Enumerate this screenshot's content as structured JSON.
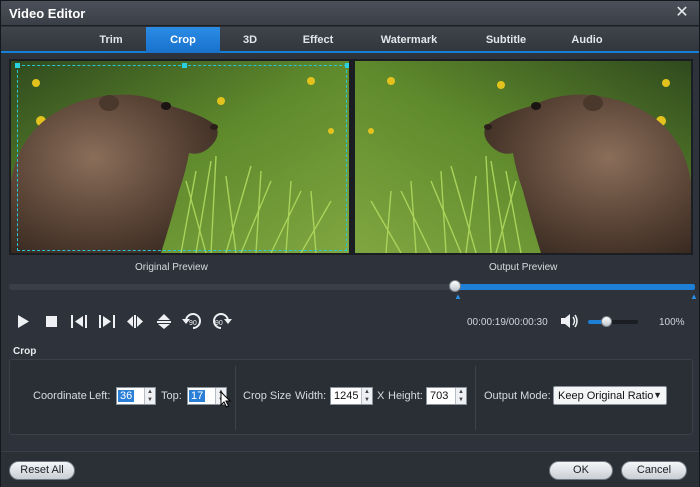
{
  "window": {
    "title": "Video Editor",
    "close_glyph": "✕"
  },
  "tabs": [
    {
      "label": "Trim",
      "active": false
    },
    {
      "label": "Crop",
      "active": true
    },
    {
      "label": "3D",
      "active": false
    },
    {
      "label": "Effect",
      "active": false
    },
    {
      "label": "Watermark",
      "active": false
    },
    {
      "label": "Subtitle",
      "active": false
    },
    {
      "label": "Audio",
      "active": false
    }
  ],
  "preview": {
    "original_label": "Original Preview",
    "output_label": "Output Preview"
  },
  "playback": {
    "position_fraction": 0.65,
    "current_time": "00:00:19",
    "total_time": "00:00:30",
    "time_text": "00:00:19/00:00:30",
    "volume_fraction": 0.35,
    "volume_text": "100%",
    "icons": [
      "play-icon",
      "stop-icon",
      "previous-frame-icon",
      "next-frame-icon",
      "flip-horizontal-icon",
      "flip-vertical-icon",
      "rotate-left-90-icon",
      "rotate-right-90-icon",
      "speaker-icon"
    ],
    "rotate_left_text": "90",
    "rotate_right_text": "90"
  },
  "crop": {
    "section_title": "Crop",
    "coordinate_label": "Coordinate",
    "left_label": "Left:",
    "left_value": "36",
    "top_label": "Top:",
    "top_value": "17",
    "crop_size_label": "Crop Size",
    "width_label": "Width:",
    "width_value": "1245",
    "x_label": "X",
    "height_label": "Height:",
    "height_value": "703",
    "output_mode_label": "Output Mode:",
    "output_mode_value": "Keep Original Ratio"
  },
  "footer": {
    "reset_label": "Reset All",
    "ok_label": "OK",
    "cancel_label": "Cancel"
  },
  "colors": {
    "accent": "#1e7fd6",
    "crop_outline": "#27c6d8",
    "background": "#2e333b"
  }
}
